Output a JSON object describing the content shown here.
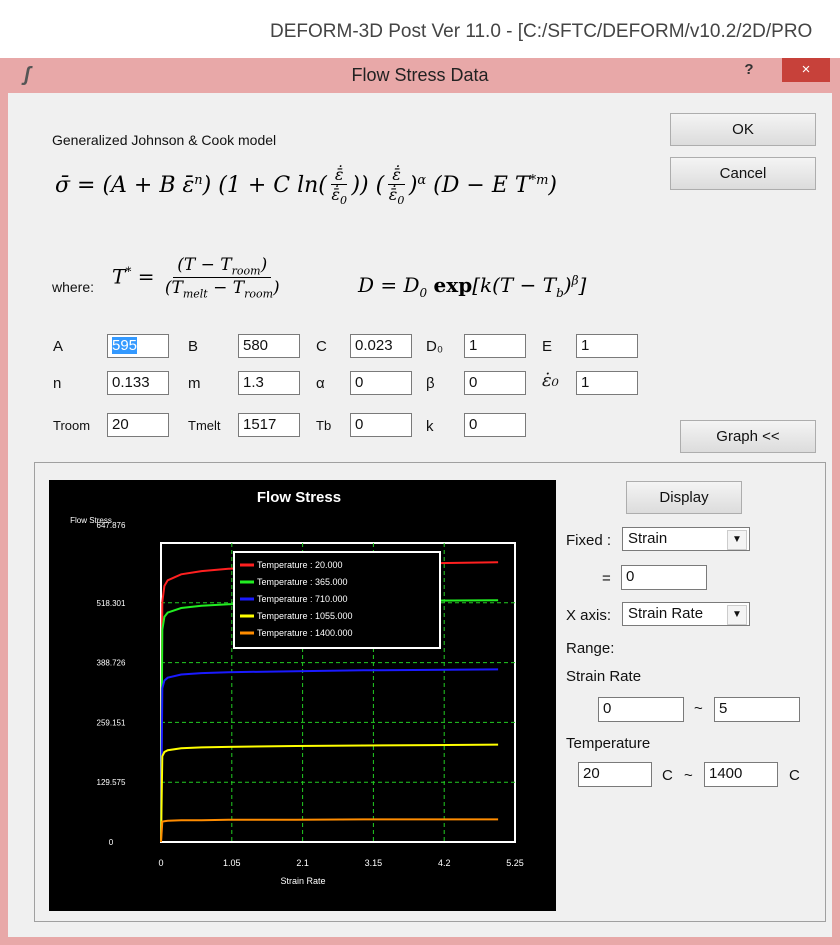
{
  "app_title": "DEFORM-3D Post Ver 11.0 - [C:/SFTC/DEFORM/v10.2/2D/PRO",
  "dialog": {
    "title": "Flow Stress Data",
    "help": "?",
    "close": "×",
    "ok": "OK",
    "cancel": "Cancel",
    "graph": "Graph <<"
  },
  "model": {
    "name": "Generalized Johnson & Cook model",
    "where": "where:"
  },
  "params": [
    {
      "label": "A",
      "value": "595",
      "selected": true
    },
    {
      "label": "B",
      "value": "580"
    },
    {
      "label": "C",
      "value": "0.023"
    },
    {
      "label": "D₀",
      "value": "1"
    },
    {
      "label": "E",
      "value": "1"
    },
    {
      "label": "n",
      "value": "0.133"
    },
    {
      "label": "m",
      "value": "1.3"
    },
    {
      "label": "α",
      "value": "0"
    },
    {
      "label": "β",
      "value": "0"
    },
    {
      "label": "ε̇₀",
      "value": "1"
    },
    {
      "label": "Troom",
      "value": "20"
    },
    {
      "label": "Tmelt",
      "value": "1517"
    },
    {
      "label": "Tb",
      "value": "0"
    },
    {
      "label": "k",
      "value": "0"
    }
  ],
  "controls": {
    "display": "Display",
    "fixed_label": "Fixed :",
    "fixed_value": "Strain",
    "equals": "=",
    "fixed_input": "0",
    "xaxis_label": "X axis:",
    "xaxis_value": "Strain Rate",
    "range": "Range:",
    "strain_rate": "Strain Rate",
    "sr_min": "0",
    "tilde": "~",
    "sr_max": "5",
    "temperature": "Temperature",
    "t_min": "20",
    "t_unit": "C",
    "t_max": "1400"
  },
  "chart_data": {
    "type": "line",
    "title": "Flow Stress",
    "ylabel": "Flow Stress",
    "xlabel": "Strain Rate",
    "xlim": [
      0,
      5.25
    ],
    "ylim": [
      0,
      647.876
    ],
    "xticks": [
      "0",
      "1.05",
      "2.1",
      "3.15",
      "4.2",
      "5.25"
    ],
    "yticks": [
      "0",
      "129.575",
      "259.151",
      "388.726",
      "518.301",
      "647.876"
    ],
    "grid": true,
    "legend_position": "top-center",
    "series": [
      {
        "name": "Temperature : 20.000",
        "color": "#ff2020",
        "x": [
          0,
          0.02,
          0.05,
          0.1,
          0.3,
          0.6,
          1,
          2,
          3,
          4,
          5
        ],
        "y": [
          0,
          520,
          555,
          567,
          580,
          587,
          592,
          598,
          601,
          604,
          606
        ]
      },
      {
        "name": "Temperature : 365.000",
        "color": "#22ee22",
        "x": [
          0,
          0.02,
          0.05,
          0.1,
          0.3,
          0.6,
          1,
          2,
          3,
          4,
          5
        ],
        "y": [
          0,
          460,
          488,
          497,
          507,
          512,
          515,
          519,
          521,
          523,
          524
        ]
      },
      {
        "name": "Temperature : 710.000",
        "color": "#1a1aff",
        "x": [
          0,
          0.02,
          0.05,
          0.1,
          0.3,
          0.6,
          1,
          2,
          3,
          4,
          5
        ],
        "y": [
          0,
          333,
          350,
          356,
          363,
          366,
          368,
          370,
          372,
          373,
          374
        ]
      },
      {
        "name": "Temperature : 1055.000",
        "color": "#ffff00",
        "x": [
          0,
          0.02,
          0.05,
          0.1,
          0.3,
          0.6,
          1,
          2,
          3,
          4,
          5
        ],
        "y": [
          0,
          186,
          195,
          199,
          203,
          205,
          206,
          208,
          209,
          210,
          211
        ]
      },
      {
        "name": "Temperature : 1400.000",
        "color": "#ff8c00",
        "x": [
          0,
          0.02,
          0.05,
          0.1,
          0.3,
          0.6,
          1,
          2,
          3,
          4,
          5
        ],
        "y": [
          0,
          44,
          45,
          46,
          47,
          47,
          48,
          48,
          49,
          49,
          49
        ]
      }
    ]
  }
}
